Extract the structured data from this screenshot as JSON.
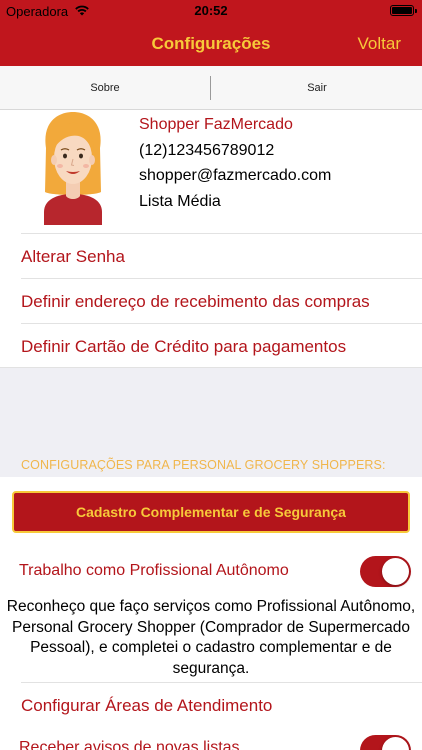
{
  "status_bar": {
    "carrier": "Operadora",
    "time": "20:52",
    "wifi_icon": "wifi-icon",
    "battery_icon": "battery-icon"
  },
  "nav": {
    "title": "Configurações",
    "back_label": "Voltar",
    "accent_color": "#f7c93a",
    "bar_color": "#c0161d"
  },
  "segments": [
    {
      "label": "Sobre"
    },
    {
      "label": "Sair"
    }
  ],
  "profile": {
    "avatar_icon": "woman-avatar-icon",
    "name": "Shopper FazMercado",
    "phone": "(12)123456789012",
    "email": "shopper@fazmercado.com",
    "list_type": "Lista Média"
  },
  "menu": [
    {
      "label": "Alterar Senha"
    },
    {
      "label": "Definir endereço de recebimento das compras"
    },
    {
      "label": "Definir Cartão de Crédito para pagamentos"
    }
  ],
  "personal_shoppers": {
    "section_title": "CONFIGURAÇÕES PARA PERSONAL GROCERY SHOPPERS:",
    "cta_label": "Cadastro Complementar e de Segurança",
    "autonomo": {
      "label": "Trabalho como Profissional Autônomo",
      "enabled": true,
      "description": "Reconheço que faço serviços como Profissional Autônomo, Personal Grocery Shopper (Comprador de Supermercado Pessoal), e completei o cadastro complementar e de segurança."
    },
    "areas_label": "Configurar Áreas de Atendimento",
    "avisos": {
      "label": "Receber avisos de novas listas",
      "enabled": true
    }
  }
}
